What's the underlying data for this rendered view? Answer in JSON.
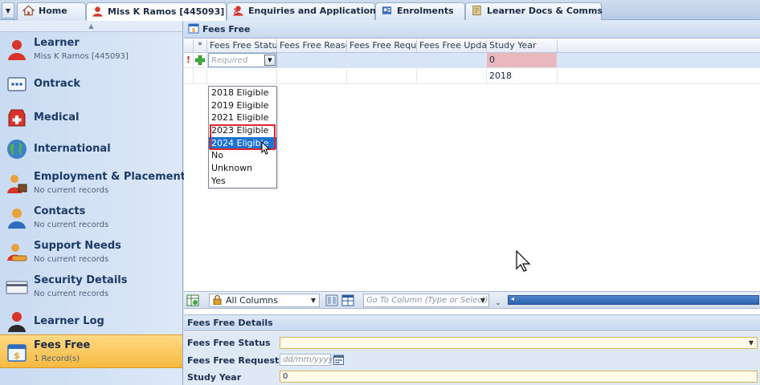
{
  "tabs": [
    {
      "label": "Home",
      "icon": "home-icon"
    },
    {
      "label": "Miss K Ramos [445093]",
      "icon": "user-icon",
      "active": true,
      "close": "✕"
    },
    {
      "label": "Enquiries and Applications",
      "icon": "user-icon"
    },
    {
      "label": "Enrolments",
      "icon": "enrolment-icon"
    },
    {
      "label": "Learner Docs & Comms",
      "icon": "docs-icon"
    }
  ],
  "nav": {
    "items": [
      {
        "title": "Learner",
        "sub": "Miss K Ramos [445093]"
      },
      {
        "title": "Ontrack",
        "sub": ""
      },
      {
        "title": "Medical",
        "sub": ""
      },
      {
        "title": "International",
        "sub": ""
      },
      {
        "title": "Employment & Placements",
        "sub": "No current records"
      },
      {
        "title": "Contacts",
        "sub": "No current records"
      },
      {
        "title": "Support Needs",
        "sub": "No current records"
      },
      {
        "title": "Security Details",
        "sub": "No current records"
      },
      {
        "title": "Learner Log",
        "sub": ""
      },
      {
        "title": "Fees Free",
        "sub": "1 Record(s)"
      }
    ]
  },
  "panel": {
    "title": "Fees Free",
    "columns": [
      "*",
      "Fees Free Status",
      "Fees Free Reason",
      "Fees Free Requ...",
      "Fees Free Upda...",
      "Study Year"
    ],
    "new_row": {
      "indicator": "!",
      "status_placeholder": "Required",
      "study_year": "0"
    },
    "rows": [
      {
        "study_year": "2018"
      }
    ],
    "dropdown_options": [
      "2018 Eligible",
      "2019 Eligible",
      "2021 Eligible",
      "2023 Eligible",
      "2024 Eligible",
      "No",
      "Unknown",
      "Yes"
    ],
    "highlighted_option": "2024 Eligible"
  },
  "toolbar": {
    "columns_select": "All Columns",
    "goto_placeholder": "Go To Column (Type or Select)"
  },
  "details": {
    "title": "Fees Free Details",
    "status_label": "Fees Free Status",
    "request_date_label": "Fees Free Request Date",
    "request_date_placeholder": "dd/mm/yyyy",
    "study_year_label": "Study Year",
    "study_year_value": "0"
  }
}
